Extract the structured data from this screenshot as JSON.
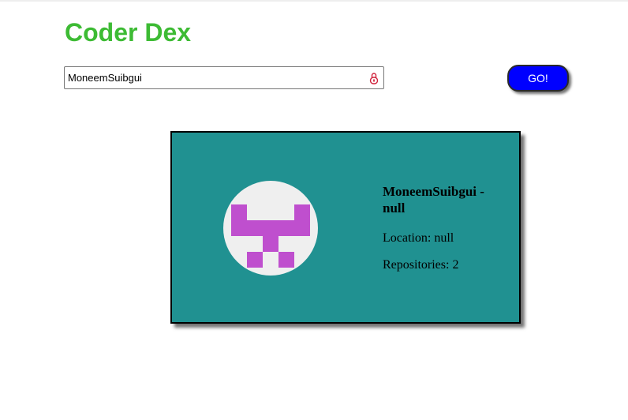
{
  "header": {
    "title": "Coder Dex",
    "title_color": "#3dbb34"
  },
  "search": {
    "value": "MoneemSuibgui",
    "icon": "lock-icon",
    "icon_color": "#d0213b"
  },
  "go_button": {
    "label": "GO!",
    "color": "#0000ff"
  },
  "profile_card": {
    "background": "#209191",
    "avatar": {
      "description_icon": "identicon-avatar",
      "pattern_color": "#bf4fce",
      "background": "#efefef"
    },
    "username": "MoneemSuibgui",
    "name_separator": " - ",
    "name": "null",
    "location_label": "Location: ",
    "location": "null",
    "repos_label": "Repositories: ",
    "repos": "2"
  }
}
